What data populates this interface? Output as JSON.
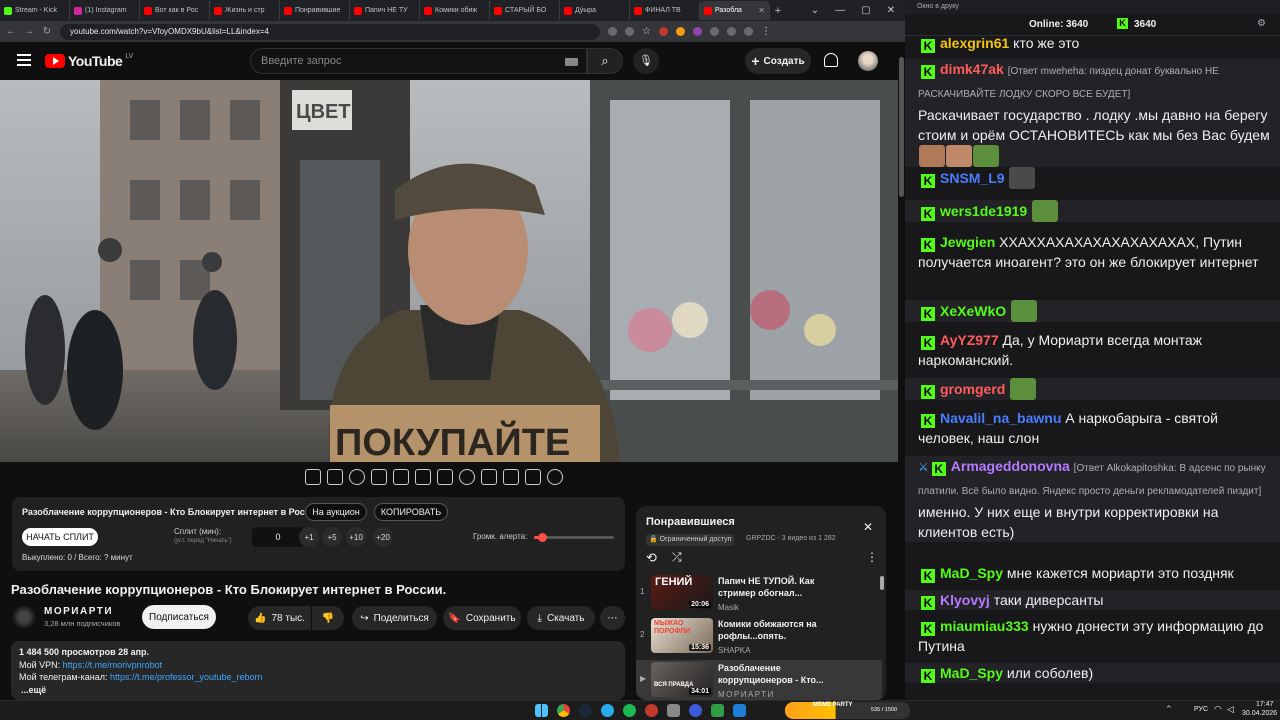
{
  "browser": {
    "tabs": [
      {
        "label": "Stream - Kick",
        "color": "#53fc18"
      },
      {
        "label": "(1) Instagram",
        "color": "#d6249f"
      },
      {
        "label": "Вот как в Рос",
        "color": "#ff0000"
      },
      {
        "label": "Жизнь и стр",
        "color": "#ff0000"
      },
      {
        "label": "Понравившие",
        "color": "#ff0000"
      },
      {
        "label": "Папич НЕ ТУ",
        "color": "#ff0000"
      },
      {
        "label": "Комики обиж",
        "color": "#ff0000"
      },
      {
        "label": "СТАРЫЙ БО",
        "color": "#ff0000"
      },
      {
        "label": "Дýырa",
        "color": "#ff0000"
      },
      {
        "label": "ФИНАЛ ТВ",
        "color": "#ff0000"
      },
      {
        "label": "Разобла",
        "color": "#ff0000"
      }
    ],
    "url": "youtube.com/watch?v=VfoyOMDX9bU&list=LL&index=4"
  },
  "youtube": {
    "logo": "YouTube",
    "region": "LV",
    "search_placeholder": "Введите запрос",
    "create_label": "Создать",
    "extension": {
      "title": "Разоблачение коррупционеров - Кто Блокирует интернет в России.",
      "auction_label": "На аукцион",
      "copy_label": "КОПИРОВАТЬ",
      "start_split_label": "НАЧАТЬ СПЛИТ",
      "split_label": "Сплит (мин):",
      "split_hint": "(уст. перед \"Начать\")",
      "split_value": "0",
      "increments": [
        "+1",
        "+5",
        "+10",
        "+20"
      ],
      "volume_label": "Громк. алерта:",
      "volume_level": 0.1,
      "bought_label": "Выкуплено: 0 / Всего: ? минут"
    },
    "video": {
      "sign_text": "ПОКУПАЙТЕ",
      "shop_sign": "ЦВЕТ",
      "title": "Разоблачение коррупционеров - Кто Блокирует интернет в России.",
      "channel": "МОРИАРТИ",
      "subscribers": "3,28 млн подписчиков",
      "subscribe_label": "Подписаться",
      "likes": "78 тыс.",
      "share_label": "Поделиться",
      "save_label": "Сохранить",
      "download_label": "Скачать",
      "views_date": "1 484 500 просмотров  28 апр.",
      "vpn_prefix": "Мой VPN: ",
      "vpn_link": "https://t.me/morivpnrobot",
      "tg_prefix": "Мой телеграм-канал: ",
      "tg_link": "https://t.me/professor_youtube_reborn",
      "more_label": "...ещё"
    },
    "playlist": {
      "title": "Понравившиеся",
      "access": "Ограниченный доступ",
      "meta": "GRPZDC - 3 видео из 1 282",
      "items": [
        {
          "num": "1",
          "title": "Папич НЕ ТУПОЙ. Как стример обогнал...",
          "channel": "Masik",
          "duration": "20:06",
          "thumb_text": "ГЕНИЙ"
        },
        {
          "num": "2",
          "title": "Комики обижаются на рофлы...опять.",
          "channel": "SHAPKA",
          "duration": "15:36",
          "thumb_text": "МЫЖАО ПОРОФЛИ"
        },
        {
          "num": "▶",
          "title": "Разоблачение коррупционеров - Кто...",
          "channel": "МОРИАРТИ",
          "duration": "34:01",
          "thumb_text": "ВСЯ ПРАВДА"
        }
      ]
    }
  },
  "chat": {
    "window_title": "Окно в друку",
    "online_label": "Online:",
    "online_count": "3640",
    "kick_count": "3640",
    "messages": [
      {
        "user": "alexgrin61",
        "color": "#f1c40f",
        "text": "кто же это"
      },
      {
        "user": "dimk47ak",
        "color": "#ff5c5c",
        "reply": "[Ответ mweheha: пиздец донат буквально НЕ РАСКАЧИВАЙТЕ ЛОДКУ СКОРО ВСЕ БУДЕТ]",
        "text": "Раскачивает государство . лодку .мы давно на берегу стоим и орём ОСТАНОВИТЕСЬ как мы без Вас будем"
      },
      {
        "user": "SNSM_L9",
        "color": "#4a7dff",
        "text": ""
      },
      {
        "user": "wers1de1919",
        "color": "#53fc18",
        "text": ""
      },
      {
        "user": "Jewgien",
        "color": "#53fc18",
        "text": "ХХАХХАХАХАХАХАХАХАХАХ, Путин получается иноагент? это он же блокирует интернет"
      },
      {
        "user": "XeXeWkO",
        "color": "#53fc18",
        "text": ""
      },
      {
        "user": "AyYZ977",
        "color": "#ff5c5c",
        "text": "Да, у Мориарти всегда монтаж наркоманский."
      },
      {
        "user": "gromgerd",
        "color": "#ff5c5c",
        "text": ""
      },
      {
        "user": "Navalil_na_bawnu",
        "color": "#4a7dff",
        "text": "А наркобарыга - святой человек, наш слон"
      },
      {
        "user": "Armageddonovna",
        "color": "#b47aff",
        "reply": "[Ответ Alkokapitoshka: В адсенс по рынку платили. Всё было видно. Яндекс просто деньги рекламодателей пиздит]",
        "text": "именно. У них еще и внутри корректировки на клиентов есть)"
      },
      {
        "user": "MaD_Spy",
        "color": "#53fc18",
        "text": "мне кажется мориарти это поздняк"
      },
      {
        "user": "Klyovyj",
        "color": "#b47aff",
        "text": "таки диверсанты"
      },
      {
        "user": "miaumiau333",
        "color": "#53fc18",
        "text": "нужно донести эту информацию до Путина"
      },
      {
        "user": "MaD_Spy",
        "color": "#53fc18",
        "text": "или соболев)"
      }
    ]
  },
  "taskbar": {
    "banner": "MEME PARTY",
    "banner_count": "535 / 1500",
    "lang": "РУС",
    "time": "17:47",
    "date": "30.04.2026"
  }
}
